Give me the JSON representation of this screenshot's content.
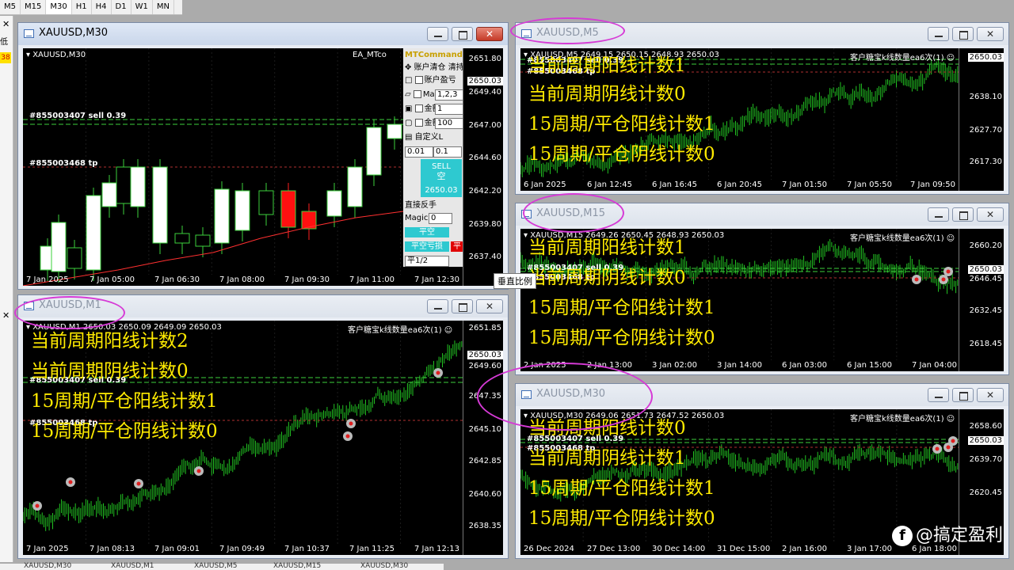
{
  "timeframes": [
    "M5",
    "M15",
    "M30",
    "H1",
    "H4",
    "D1",
    "W1",
    "MN"
  ],
  "active_timeframe": "M30",
  "left_strip": {
    "close1": "✕",
    "text1": "低",
    "badge": "38",
    "close2": "✕"
  },
  "tooltip": "垂直比例",
  "watermark": "@搞定盈利",
  "windows": {
    "m30": {
      "title": "XAUUSD,M30",
      "symbol": "▾ XAUUSD,M30",
      "ea_label": "EA_MTco",
      "current_price": "2650.03",
      "order_sell": "#855003407 sell 0.39",
      "order_tp": "#855003468 tp",
      "prices": [
        "2651.80",
        "2649.40",
        "2647.00",
        "2644.60",
        "2642.20",
        "2639.80",
        "2637.40"
      ],
      "times": [
        "7 Jan 2025",
        "7 Jan 05:00",
        "7 Jan 06:30",
        "7 Jan 08:00",
        "7 Jan 09:30",
        "7 Jan 11:00",
        "7 Jan 12:30"
      ],
      "panel": {
        "title": "MTCommande",
        "close_all": "账户清仓 清持",
        "acct_profit": "账户盈亏",
        "magic_label": "Mag",
        "magic_value": "1,2,3",
        "amount_label": "金额",
        "amount_value1": "1",
        "amount_value2": "100",
        "custom": "自定义L",
        "lot1": "0.01",
        "lot2": "0.1",
        "sell_label": "SELL",
        "sell_sub": "空",
        "sell_price": "2650.03",
        "reverse": "直接反手",
        "magic2_label": "Magic",
        "magic2_value": "0",
        "half_short": "平空",
        "half_short_loss": "平空亏损",
        "half": "平1/2",
        "red_btn": "平"
      }
    },
    "m5": {
      "title": "XAUUSD,M5",
      "symbol": "▾ XAUUSD,M5  2649.15 2650.15 2648.93 2650.03",
      "ea_label": "客户糖宝k线数量ea6次(1) ☺",
      "current_price": "2650.03",
      "order_sell": "#855003407 sell 0.39",
      "order_tp": "#855003468 tp",
      "texts": [
        "当前周期阳线计数1",
        "当前周期阴线计数0",
        "15周期/平仓阳线计数1",
        "15周期/平仓阴线计数0"
      ],
      "prices": [
        "2650.03",
        "2638.10",
        "2627.70",
        "2617.30"
      ],
      "times": [
        "6 Jan 2025",
        "6 Jan 12:45",
        "6 Jan 16:45",
        "6 Jan 20:45",
        "7 Jan 01:50",
        "7 Jan 05:50",
        "7 Jan 09:50"
      ]
    },
    "m15": {
      "title": "XAUUSD,M15",
      "symbol": "▾ XAUUSD,M15  2649.26 2650.45 2648.93 2650.03",
      "ea_label": "客户糖宝k线数量ea6次(1) ☺",
      "current_price": "2650.03",
      "order_sell": "#855003407 sell 0.39",
      "order_tp": "#855003468 tp",
      "texts": [
        "当前周期阳线计数1",
        "当前周期阴线计数0",
        "15周期/平仓阳线计数1",
        "15周期/平仓阴线计数0"
      ],
      "prices": [
        "2660.20",
        "2646.45",
        "2632.45",
        "2618.45"
      ],
      "times": [
        "2 Jan 2025",
        "2 Jan 13:00",
        "3 Jan 02:00",
        "3 Jan 14:00",
        "6 Jan 03:00",
        "6 Jan 15:00",
        "7 Jan 04:00"
      ]
    },
    "m1": {
      "title": "XAUUSD,M1",
      "symbol": "▾ XAUUSD,M1  2650.03 2650.09 2649.09 2650.03",
      "ea_label": "客户糖宝k线数量ea6次(1) ☺",
      "current_price": "2650.03",
      "order_sell": "#855003407 sell 0.39",
      "order_tp": "#855003468 tp",
      "texts": [
        "当前周期阳线计数2",
        "当前周期阴线计数0",
        "15周期/平仓阳线计数1",
        "15周期/平仓阴线计数0"
      ],
      "prices": [
        "2651.85",
        "2649.60",
        "2647.35",
        "2645.10",
        "2642.85",
        "2640.60",
        "2638.35"
      ],
      "times": [
        "7 Jan 2025",
        "7 Jan 08:13",
        "7 Jan 09:01",
        "7 Jan 09:49",
        "7 Jan 10:37",
        "7 Jan 11:25",
        "7 Jan 12:13"
      ]
    },
    "m30b": {
      "title": "XAUUSD,M30",
      "symbol": "▾ XAUUSD,M30  2649.06 2651.73 2647.52 2650.03",
      "ea_label": "客户糖宝k线数量ea6次(1) ☺",
      "current_price": "2650.03",
      "order_sell": "#855003407 sell 0.39",
      "order_tp": "#855003468 tp",
      "texts": [
        "当前周期阳线计数0",
        "当前周期阴线计数1",
        "15周期/平仓阳线计数1",
        "15周期/平仓阴线计数0"
      ],
      "prices": [
        "2658.60",
        "2639.70",
        "2620.45"
      ],
      "times": [
        "26 Dec 2024",
        "27 Dec 13:00",
        "30 Dec 14:00",
        "31 Dec 15:00",
        "2 Jan 16:00",
        "3 Jan 17:00",
        "6 Jan 18:00"
      ]
    }
  },
  "bottom_tabs": [
    "XAUUSD,M30",
    "XAUUSD,M1",
    "XAUUSD,M5",
    "XAUUSD,M15",
    "XAUUSD,M30"
  ]
}
